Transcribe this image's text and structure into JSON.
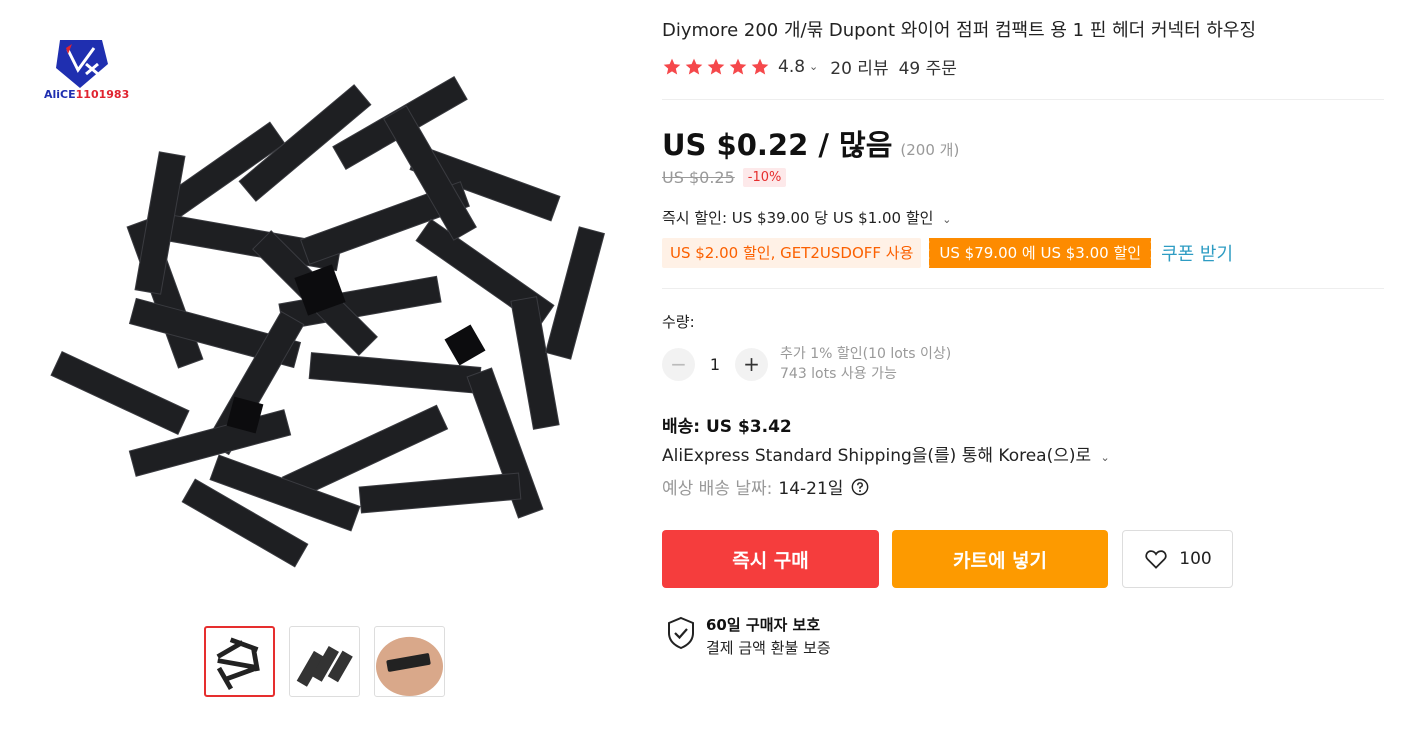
{
  "brand": {
    "logo_text_blue": "AliCE",
    "logo_text_red": "1101983"
  },
  "product": {
    "title": "Diymore 200 개/묶 Dupont 와이어 점퍼 컴팩트 용 1 핀 헤더 커넥터 하우징",
    "rating": "4.8",
    "reviews": "20 리뷰",
    "orders": "49 주문",
    "stars_filled": 5
  },
  "pricing": {
    "price": "US $0.22 / 많음",
    "unit": "(200 개)",
    "old_price": "US $0.25",
    "discount": "-10%",
    "instant_discount": "즉시 할인: US $39.00 당 US $1.00 할인",
    "coupon1": "US $2.00 할인, GET2USDOFF 사용",
    "coupon2": "US $79.00 에 US $3.00 할인",
    "coupon_link": "쿠폰 받기"
  },
  "quantity": {
    "label": "수량:",
    "value": "1",
    "note1": "추가 1% 할인(10 lots 이상)",
    "note2": "743 lots 사용 가능"
  },
  "shipping": {
    "cost": "배송: US $3.42",
    "method": "AliExpress Standard Shipping을(를) 통해 Korea(으)로",
    "date_label": "예상 배송 날짜:",
    "days": "14-21일"
  },
  "actions": {
    "buy_now": "즉시 구매",
    "add_to_cart": "카트에 넣기",
    "wishlist_count": "100"
  },
  "protection": {
    "title": "60일 구매자 보호",
    "subtitle": "결제 금액 환불 보증"
  },
  "colors": {
    "accent_red": "#f53d3d",
    "accent_orange": "#fd9a00",
    "star": "#f5484b",
    "link": "#2e9cc3"
  }
}
